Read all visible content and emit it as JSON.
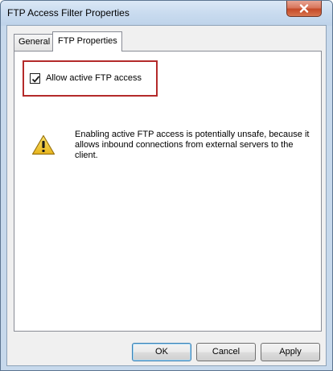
{
  "window": {
    "title": "FTP Access Filter Properties"
  },
  "tabs": [
    {
      "label": "General",
      "selected": false
    },
    {
      "label": "FTP Properties",
      "selected": true
    }
  ],
  "ftp_properties": {
    "allow_active_ftp": {
      "label": "Allow active FTP access",
      "checked": true
    },
    "warning_text": "Enabling active FTP access is potentially unsafe, because it allows inbound connections from external servers to the client.",
    "warning_icon": "warning-triangle-icon"
  },
  "buttons": {
    "ok": "OK",
    "cancel": "Cancel",
    "apply": "Apply"
  },
  "colors": {
    "highlight_border": "#b42a2a",
    "close_button": "#c44a28"
  }
}
